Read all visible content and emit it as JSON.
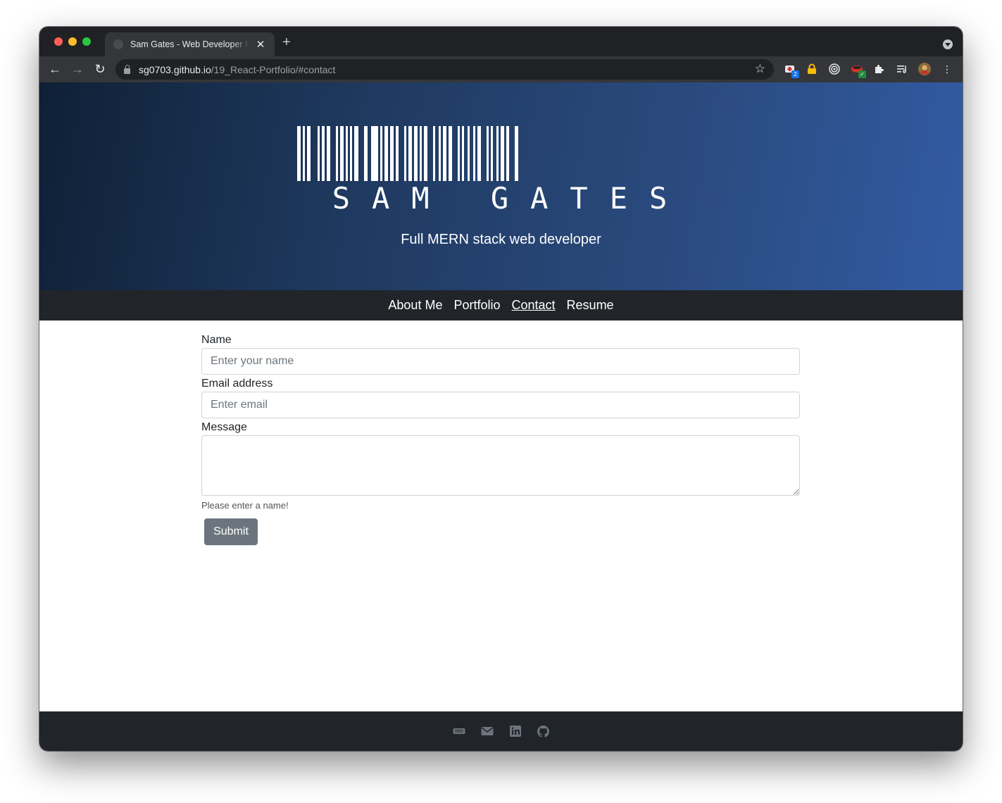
{
  "browser": {
    "tab_title": "Sam Gates - Web Developer Portfolio",
    "url_host": "sg0703.github.io",
    "url_path": "/19_React-Portfolio/#contact",
    "extension_badge_count": "2"
  },
  "header": {
    "logo_text": "SAM GATES",
    "tagline": "Full MERN stack web developer"
  },
  "nav": {
    "items": [
      {
        "label": "About Me"
      },
      {
        "label": "Portfolio"
      },
      {
        "label": "Contact",
        "active": true
      },
      {
        "label": "Resume"
      }
    ]
  },
  "form": {
    "name_label": "Name",
    "name_placeholder": "Enter your name",
    "email_label": "Email address",
    "email_placeholder": "Enter email",
    "message_label": "Message",
    "error_message": "Please enter a name!",
    "submit_label": "Submit"
  },
  "footer": {
    "icons": [
      "keyboard-icon",
      "email-icon",
      "linkedin-icon",
      "github-icon"
    ]
  },
  "colors": {
    "hero_gradient_start": "#0f2036",
    "hero_gradient_end": "#325ba3",
    "nav_background": "#212529",
    "submit_button": "#6c757d"
  }
}
